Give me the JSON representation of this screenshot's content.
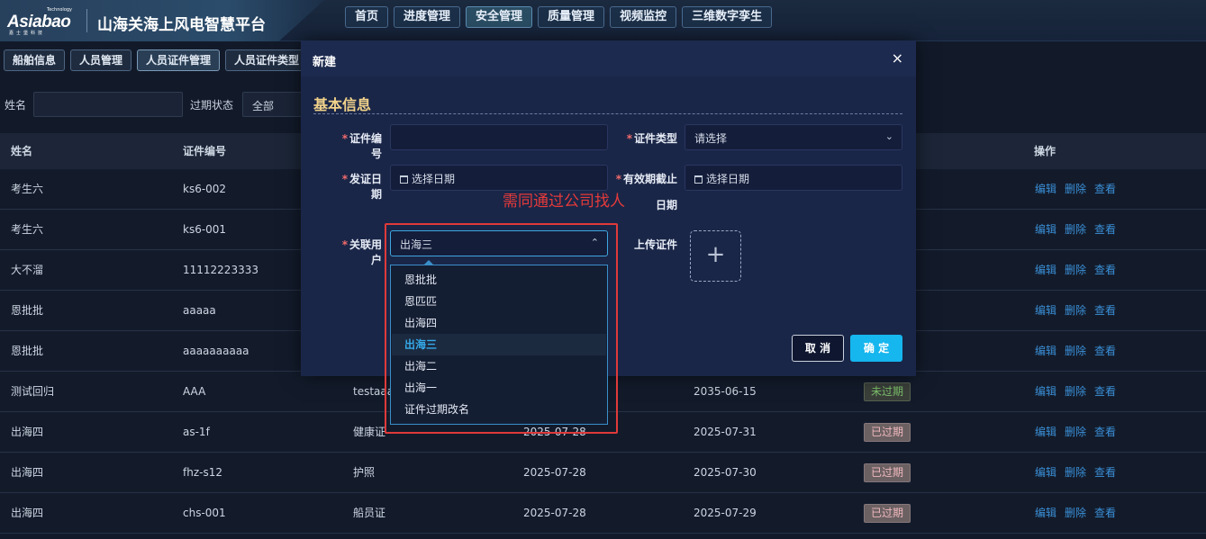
{
  "header": {
    "logo_mark": "Asiabao",
    "logo_tech": "Technology",
    "logo_sub": "嘉士堡科技",
    "title": "山海关海上风电智慧平台",
    "nav": [
      "首页",
      "进度管理",
      "安全管理",
      "质量管理",
      "视频监控",
      "三维数字孪生"
    ],
    "active_nav": "安全管理"
  },
  "subtabs": [
    "船舶信息",
    "人员管理",
    "人员证件管理",
    "人员证件类型"
  ],
  "filters": {
    "name_label": "姓名",
    "status_label": "过期状态",
    "status_value": "全部"
  },
  "table": {
    "headers": {
      "name": "姓名",
      "cert_no": "证件编号",
      "op": "操作"
    },
    "rows": [
      {
        "name": "考生六",
        "cert_no": "ks6-002",
        "type": "",
        "issue": "",
        "expire": "",
        "status": "",
        "status_kind": ""
      },
      {
        "name": "考生六",
        "cert_no": "ks6-001",
        "type": "",
        "issue": "",
        "expire": "",
        "status": "",
        "status_kind": ""
      },
      {
        "name": "大不溜",
        "cert_no": "11112223333",
        "type": "",
        "issue": "",
        "expire": "",
        "status": "",
        "status_kind": ""
      },
      {
        "name": "恩批批",
        "cert_no": "aaaaa",
        "type": "",
        "issue": "",
        "expire": "",
        "status": "",
        "status_kind": ""
      },
      {
        "name": "恩批批",
        "cert_no": "aaaaaaaaaa",
        "type": "",
        "issue": "",
        "expire": "",
        "status": "",
        "status_kind": ""
      },
      {
        "name": "测试回归",
        "cert_no": "AAA",
        "type": "testaaa",
        "issue": "",
        "expire": "2035-06-15",
        "status": "未过期",
        "status_kind": "ok"
      },
      {
        "name": "出海四",
        "cert_no": "as-1f",
        "type": "健康证",
        "issue": "2025-07-28",
        "expire": "2025-07-31",
        "status": "已过期",
        "status_kind": "expired"
      },
      {
        "name": "出海四",
        "cert_no": "fhz-s12",
        "type": "护照",
        "issue": "2025-07-28",
        "expire": "2025-07-30",
        "status": "已过期",
        "status_kind": "expired"
      },
      {
        "name": "出海四",
        "cert_no": "chs-001",
        "type": "船员证",
        "issue": "2025-07-28",
        "expire": "2025-07-29",
        "status": "已过期",
        "status_kind": "expired"
      }
    ],
    "ops": {
      "edit": "编辑",
      "delete": "删除",
      "view": "查看"
    }
  },
  "modal": {
    "title": "新建",
    "close": "×",
    "section": "基本信息",
    "fields": {
      "cert_no_label": "证件编号",
      "cert_type_label": "证件类型",
      "cert_type_placeholder": "请选择",
      "issue_date_label": "发证日期",
      "issue_date_placeholder": "选择日期",
      "expire_label_1": "有效期截止",
      "expire_label_2": "日期",
      "expire_placeholder": "选择日期",
      "user_label": "关联用户",
      "user_value": "出海三",
      "upload_label": "上传证件"
    },
    "cancel": "取 消",
    "confirm": "确 定"
  },
  "dropdown": {
    "options": [
      "恩批批",
      "恩匹匹",
      "出海四",
      "出海三",
      "出海二",
      "出海一",
      "证件过期改名"
    ],
    "selected": "出海三"
  },
  "annotation": "需同通过公司找人",
  "colors": {
    "accent": "#16b6ee",
    "annotation": "#e53a3a",
    "section_title": "#f1d28a"
  }
}
